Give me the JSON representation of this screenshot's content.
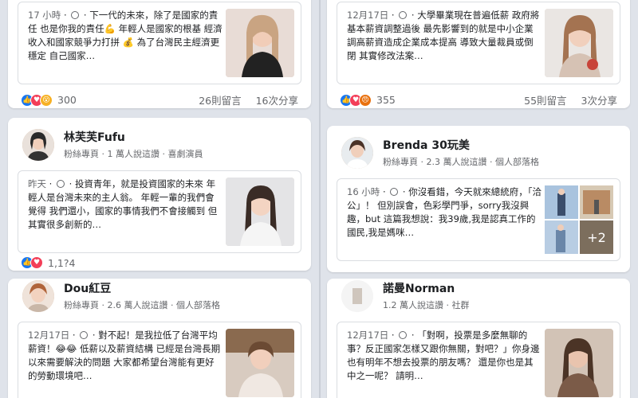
{
  "cards": {
    "left_top": {
      "post_time": "17 小時",
      "post_text": "下一代的未來，除了是國家的責任 也是你我的責任💪 年輕人是國家的根基 經濟收入和國家競爭力打拼 💰 為了台灣民主經濟更穩定 自己國家…",
      "reaction_count": "300",
      "comments": "26則留言",
      "shares": "16次分享"
    },
    "right_top": {
      "post_time": "12月17日",
      "post_text": "大學畢業現在普遍低薪 政府將基本薪資調整過後 最先影響到的就是中小企業 調高薪資造成企業成本提高 導致大量裁員或倒閉 其實修改法案…",
      "reaction_count": "355",
      "comments": "55則留言",
      "shares": "3次分享"
    },
    "left_mid": {
      "page_name": "林芙芙Fufu",
      "page_sub": "粉絲專頁 · 1 萬人說這讚 · 喜劇演員",
      "post_time": "昨天",
      "post_text": "投資青年，就是投資國家的未來 年輕人是台灣未來的主人翁。 年輕一輩的我們會覺得 我們還小，國家的事情我們不會接觸到 但其實很多創新的…",
      "partial_stats": "1,1?4"
    },
    "right_mid": {
      "page_name": "Brenda 30玩美",
      "page_sub": "粉絲專頁 · 2.3 萬人說這讚 · 個人部落格",
      "post_time": "16 小時",
      "post_text": "你沒看錯，今天就來總統府，「洽公」！ 但別誤會，色彩學門爭，sorry我沒興趣，but 這篇我想說：我39歲,我是認真工作的國民,我是媽咪…",
      "more_photos": "+2"
    },
    "left_bottom": {
      "page_name": "Dou紅豆",
      "page_sub": "粉絲專頁 · 2.6 萬人說這讚 · 個人部落格",
      "post_time": "12月17日",
      "post_text": "對不起！是我拉低了台灣平均薪資！😂😂 低薪以及薪資結構 已經是台灣長期以來需要解決的問題 大家都希望台灣能有更好的勞動環境吧…"
    },
    "right_bottom": {
      "page_name": "諾曼Norman",
      "page_sub": "1.2 萬人說這讚 · 社群",
      "post_time": "12月17日",
      "post_text": "「對啊，投票是多麼無聊的事？反正國家怎樣又跟你無關，對吧？」你身邊也有明年不想去投票的朋友嗎？ 還是你也是其中之一呢？ 請明…"
    }
  },
  "colors": {
    "like": "#1877f2",
    "love": "#f33e58",
    "wow": "#f7b125",
    "angry": "#e9710f"
  }
}
